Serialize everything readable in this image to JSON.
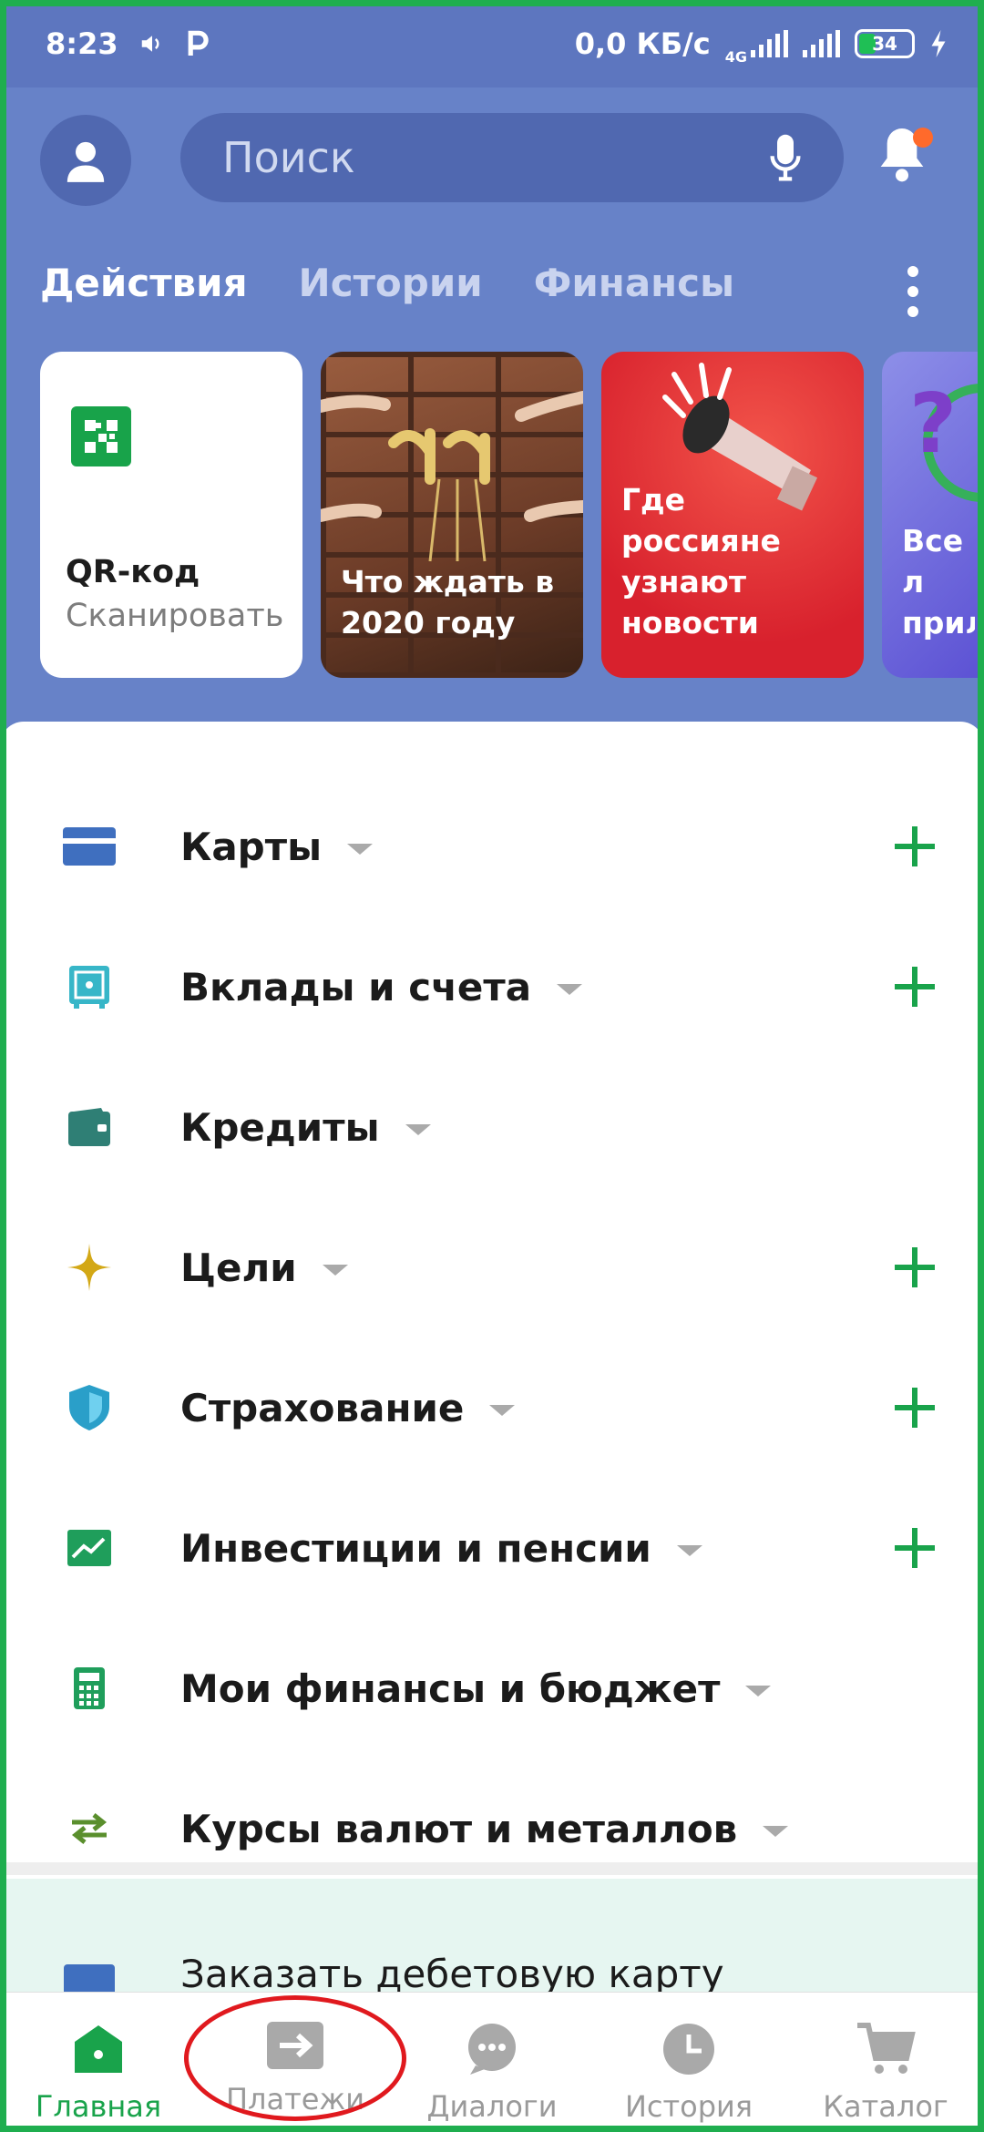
{
  "status_bar": {
    "time": "8:23",
    "network_speed": "0,0 КБ/с",
    "network_type": "4G",
    "battery": "34"
  },
  "header": {
    "search_placeholder": "Поиск",
    "tabs": [
      {
        "label": "Действия",
        "active": true
      },
      {
        "label": "Истории",
        "active": false
      },
      {
        "label": "Финансы",
        "active": false
      }
    ]
  },
  "stories": [
    {
      "title": "QR-код",
      "subtitle": "Сканировать",
      "icon": "qr-code-icon"
    },
    {
      "caption": "Что ждать в 2020 году"
    },
    {
      "caption": "Где россияне узнают новости"
    },
    {
      "caption": "Все л прило"
    }
  ],
  "sections": [
    {
      "label": "Карты",
      "icon": "card-icon",
      "color": "#3f6fbf",
      "addable": true
    },
    {
      "label": "Вклады и счета",
      "icon": "safe-icon",
      "color": "#37b6c8",
      "addable": true
    },
    {
      "label": "Кредиты",
      "icon": "wallet-icon",
      "color": "#2f7f75",
      "addable": false
    },
    {
      "label": "Цели",
      "icon": "star-icon",
      "color": "#d3a816",
      "addable": true
    },
    {
      "label": "Страхование",
      "icon": "shield-icon",
      "color": "#2a9fc9",
      "addable": true
    },
    {
      "label": "Инвестиции и пенсии",
      "icon": "chart-icon",
      "color": "#1f9e5b",
      "addable": true
    },
    {
      "label": "Мои финансы и бюджет",
      "icon": "calculator-icon",
      "color": "#1f9e5b",
      "addable": false
    },
    {
      "label": "Курсы валют и металлов",
      "icon": "exchange-icon",
      "color": "#5a8f2d",
      "addable": false
    }
  ],
  "promo": {
    "label": "Заказать дебетовую карту"
  },
  "bottom_nav": [
    {
      "label": "Главная",
      "icon": "home-icon",
      "active": true
    },
    {
      "label": "Платежи",
      "icon": "payments-icon",
      "active": false
    },
    {
      "label": "Диалоги",
      "icon": "chat-icon",
      "active": false
    },
    {
      "label": "История",
      "icon": "history-icon",
      "active": false
    },
    {
      "label": "Каталог",
      "icon": "cart-icon",
      "active": false
    }
  ],
  "colors": {
    "header_bg": "#6782c8",
    "accent_green": "#19a34b",
    "annotation_red": "#e0191e",
    "notification_dot": "#ff6a2b"
  }
}
